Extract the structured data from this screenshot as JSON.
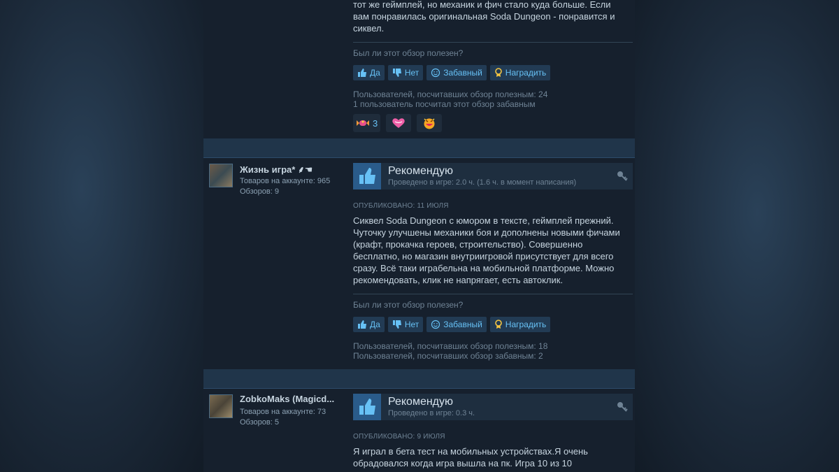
{
  "helpful_prompt": "Был ли этот обзор полезен?",
  "buttons": {
    "yes": "Да",
    "no": "Нет",
    "funny": "Забавный",
    "award": "Наградить"
  },
  "review1": {
    "text_lines": [
      "тот же геймплей, но механик и фич стало куда больше. Если",
      "вам понравилась оригинальная Soda Dungeon - понравится и",
      "сиквел."
    ],
    "helpful_stat": "Пользователей, посчитавших обзор полезным: 24",
    "funny_stat": "1 пользователь посчитал этот обзор забавным",
    "reactions": [
      {
        "icon": "sweet-award-icon",
        "count": "3"
      },
      {
        "icon": "heart-award-icon",
        "count": ""
      },
      {
        "icon": "grin-award-icon",
        "count": ""
      }
    ]
  },
  "review2": {
    "user": {
      "name": "Жизнь игра* ⸙☚",
      "products": "Товаров на аккаунте: 965",
      "reviews": "Обзоров: 9"
    },
    "verdict": "Рекомендую",
    "hours": "Проведено в игре: 2.0 ч. (1.6 ч. в момент написания)",
    "posted": "ОПУБЛИКОВАНО: 11 ИЮЛЯ",
    "text_lines": [
      "Сиквел Soda Dungeon с юмором в тексте, геймплей прежний.",
      "Чуточку улучшены механики боя и дополнены новыми фичами",
      "(крафт, прокачка героев, строительство). Совершенно",
      "бесплатно, но магазин внутриигровой присутствует для всего",
      "сразу. Всё таки играбельна на мобильной платформе. Можно",
      "рекомендовать, клик не напрягает, есть автоклик."
    ],
    "helpful_stat": "Пользователей, посчитавших обзор полезным: 18",
    "funny_stat": "Пользователей, посчитавших обзор забавным: 2"
  },
  "review3": {
    "user": {
      "name": "ZobkoMaks (Magicd...",
      "products": "Товаров на аккаунте: 73",
      "reviews": "Обзоров: 5"
    },
    "verdict": "Рекомендую",
    "hours": "Проведено в игре: 0.3 ч.",
    "posted": "ОПУБЛИКОВАНО: 9 ИЮЛЯ",
    "text_lines": [
      "Я играл в бета тест на мобильных устройствах.Я очень",
      "обрадовался когда игра вышла на пк. Игра 10 из 10"
    ]
  },
  "colors": {
    "accent": "#67c1f5",
    "button_bg": "#223b54",
    "thumb_bg": "#2a5b8a"
  }
}
